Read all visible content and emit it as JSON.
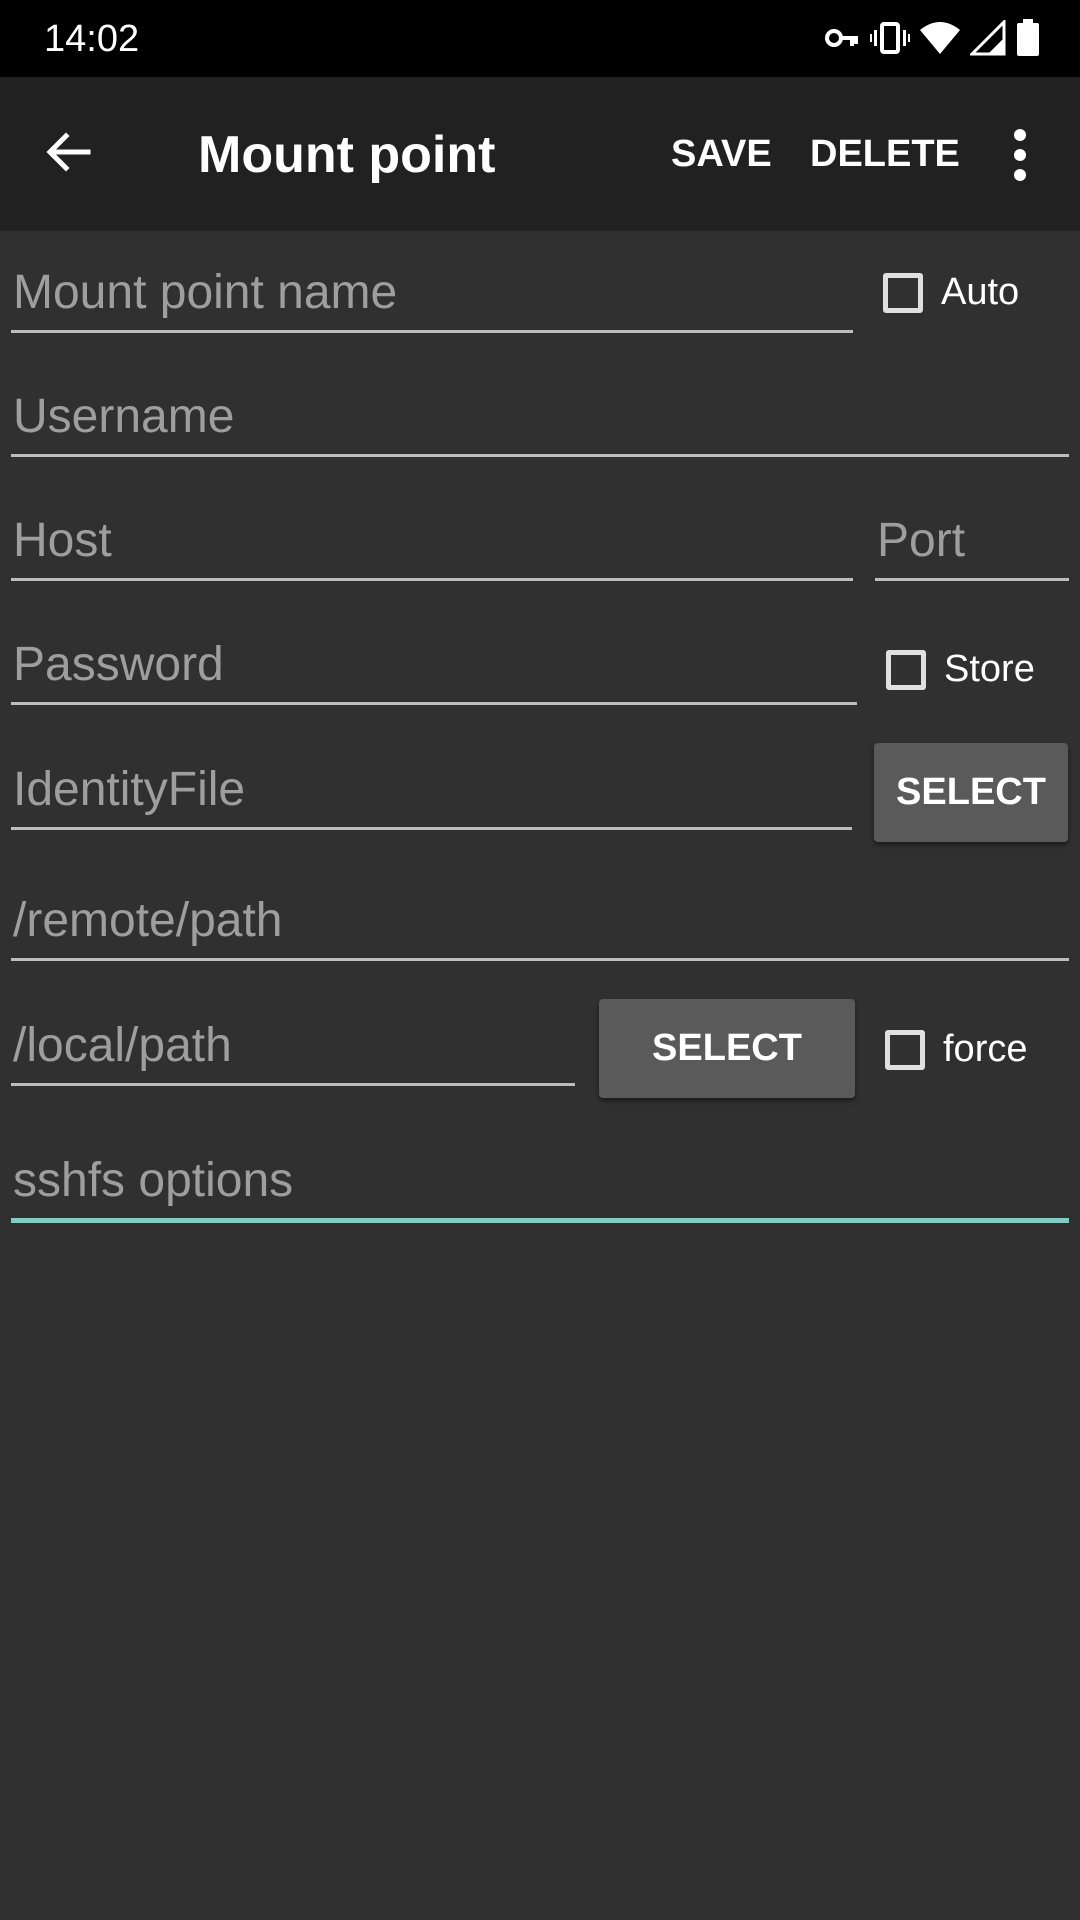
{
  "status_bar": {
    "time": "14:02",
    "icons": [
      "vpn-key-icon",
      "vibrate-icon",
      "wifi-icon",
      "cell-signal-icon",
      "battery-icon"
    ]
  },
  "toolbar": {
    "title": "Mount point",
    "save_label": "SAVE",
    "delete_label": "DELETE",
    "back_icon": "arrow-back-icon",
    "more_icon": "more-vert-icon"
  },
  "form": {
    "name_placeholder": "Mount point name",
    "auto_label": "Auto",
    "username_placeholder": "Username",
    "host_placeholder": "Host",
    "port_placeholder": "Port",
    "password_placeholder": "Password",
    "store_label": "Store",
    "identity_placeholder": "IdentityFile",
    "identity_select_label": "SELECT",
    "remote_placeholder": "/remote/path",
    "local_placeholder": "/local/path",
    "local_select_label": "SELECT",
    "force_label": "force",
    "options_placeholder": "sshfs options"
  },
  "colors": {
    "background": "#303030",
    "toolbar": "#212121",
    "accent": "#80cbc4",
    "button": "#5a5a5a"
  }
}
